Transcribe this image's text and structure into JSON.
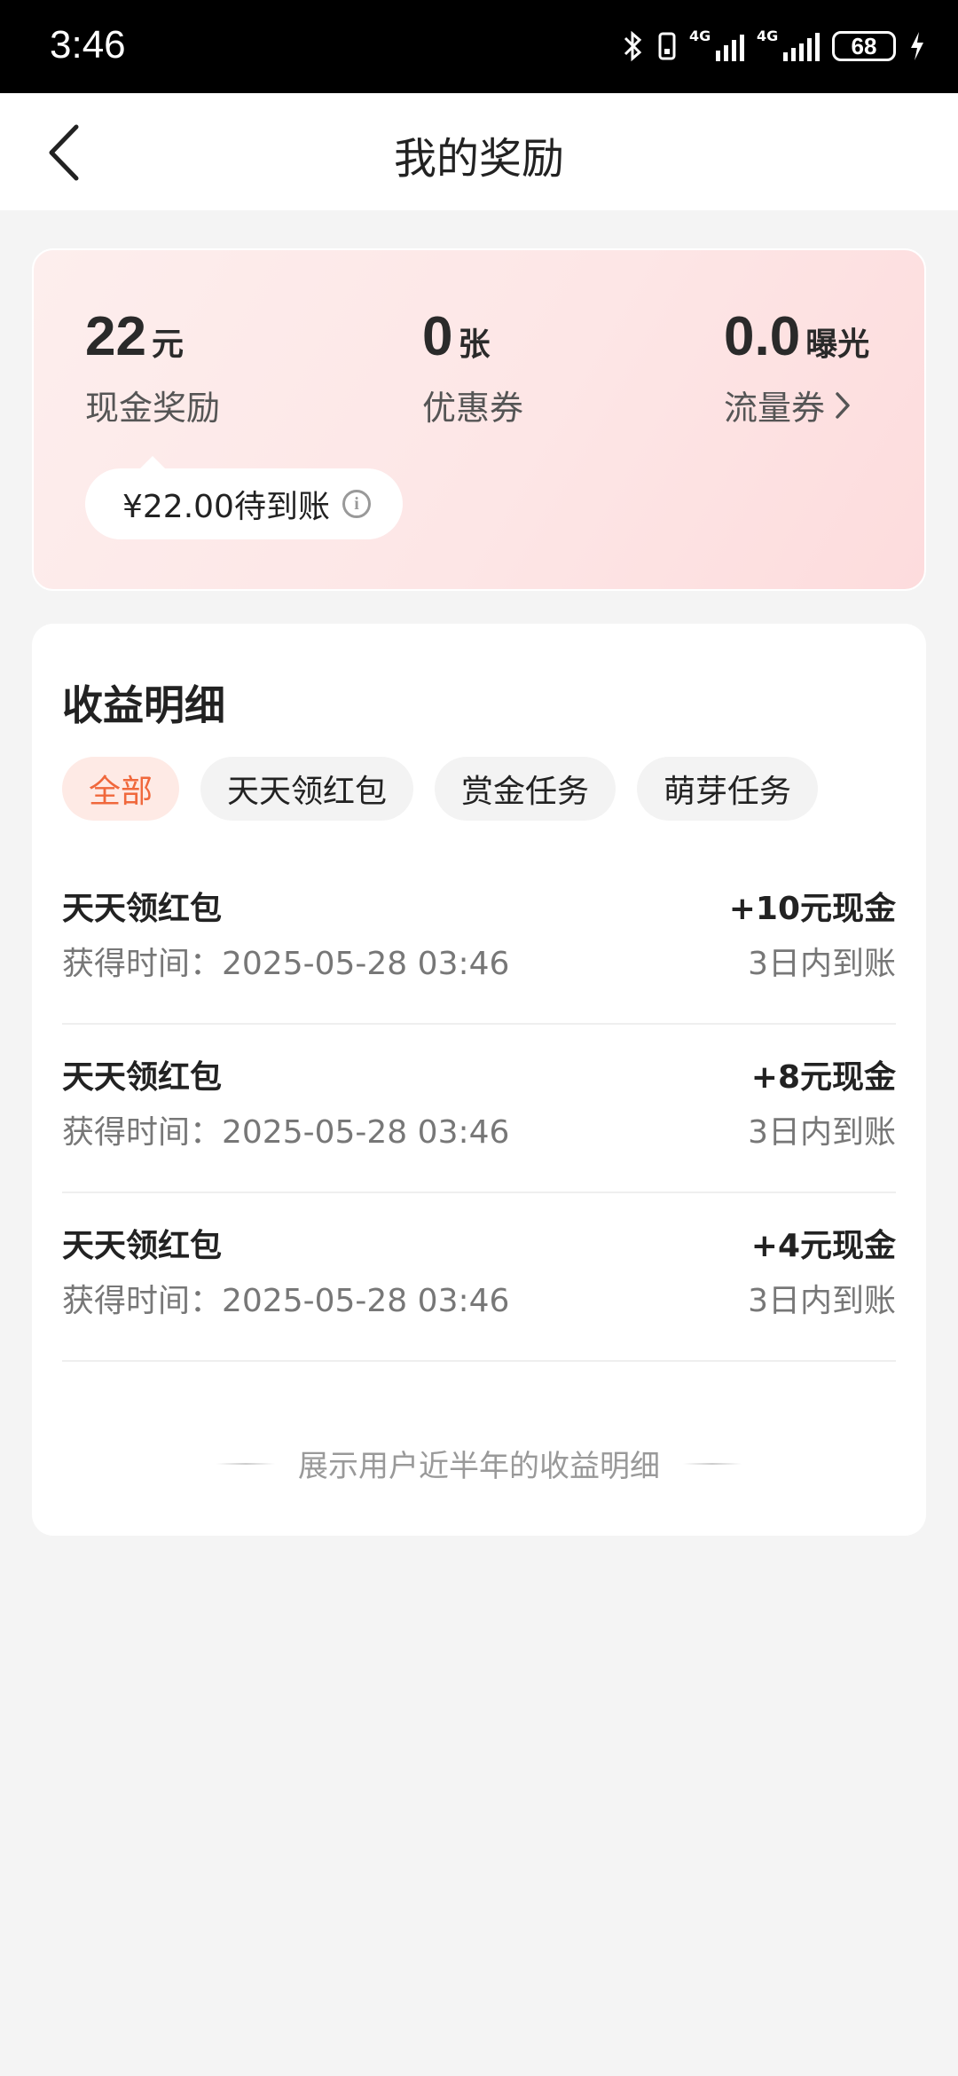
{
  "status_bar": {
    "time": "3:46",
    "signal_label_1": "4G",
    "signal_label_2": "4G",
    "battery": "68"
  },
  "header": {
    "title": "我的奖励"
  },
  "summary": {
    "cash": {
      "value": "22",
      "unit": "元",
      "label": "现金奖励"
    },
    "coupon": {
      "value": "0",
      "unit": "张",
      "label": "优惠券"
    },
    "traffic": {
      "value": "0.0",
      "unit": "曝光",
      "label": "流量券"
    },
    "pending_text": "¥22.00待到账"
  },
  "details": {
    "title": "收益明细",
    "filters": [
      "全部",
      "天天领红包",
      "赏金任务",
      "萌芽任务"
    ],
    "records": [
      {
        "name": "天天领红包",
        "time": "获得时间：2025-05-28 03:46",
        "amount": "+10元现金",
        "status": "3日内到账"
      },
      {
        "name": "天天领红包",
        "time": "获得时间：2025-05-28 03:46",
        "amount": "+8元现金",
        "status": "3日内到账"
      },
      {
        "name": "天天领红包",
        "time": "获得时间：2025-05-28 03:46",
        "amount": "+4元现金",
        "status": "3日内到账"
      }
    ],
    "footer_note": "展示用户近半年的收益明细"
  },
  "colors": {
    "accent": "#f0683c",
    "accent_bg": "#feeae5",
    "card_gradient_start": "#fdeeed",
    "card_gradient_end": "#fddcdd"
  },
  "icons": {
    "back": "chevron-left-icon",
    "info": "info-icon",
    "chevron": "chevron-right-icon",
    "bluetooth": "bluetooth-icon",
    "battery": "battery-icon",
    "charging": "charging-icon"
  }
}
